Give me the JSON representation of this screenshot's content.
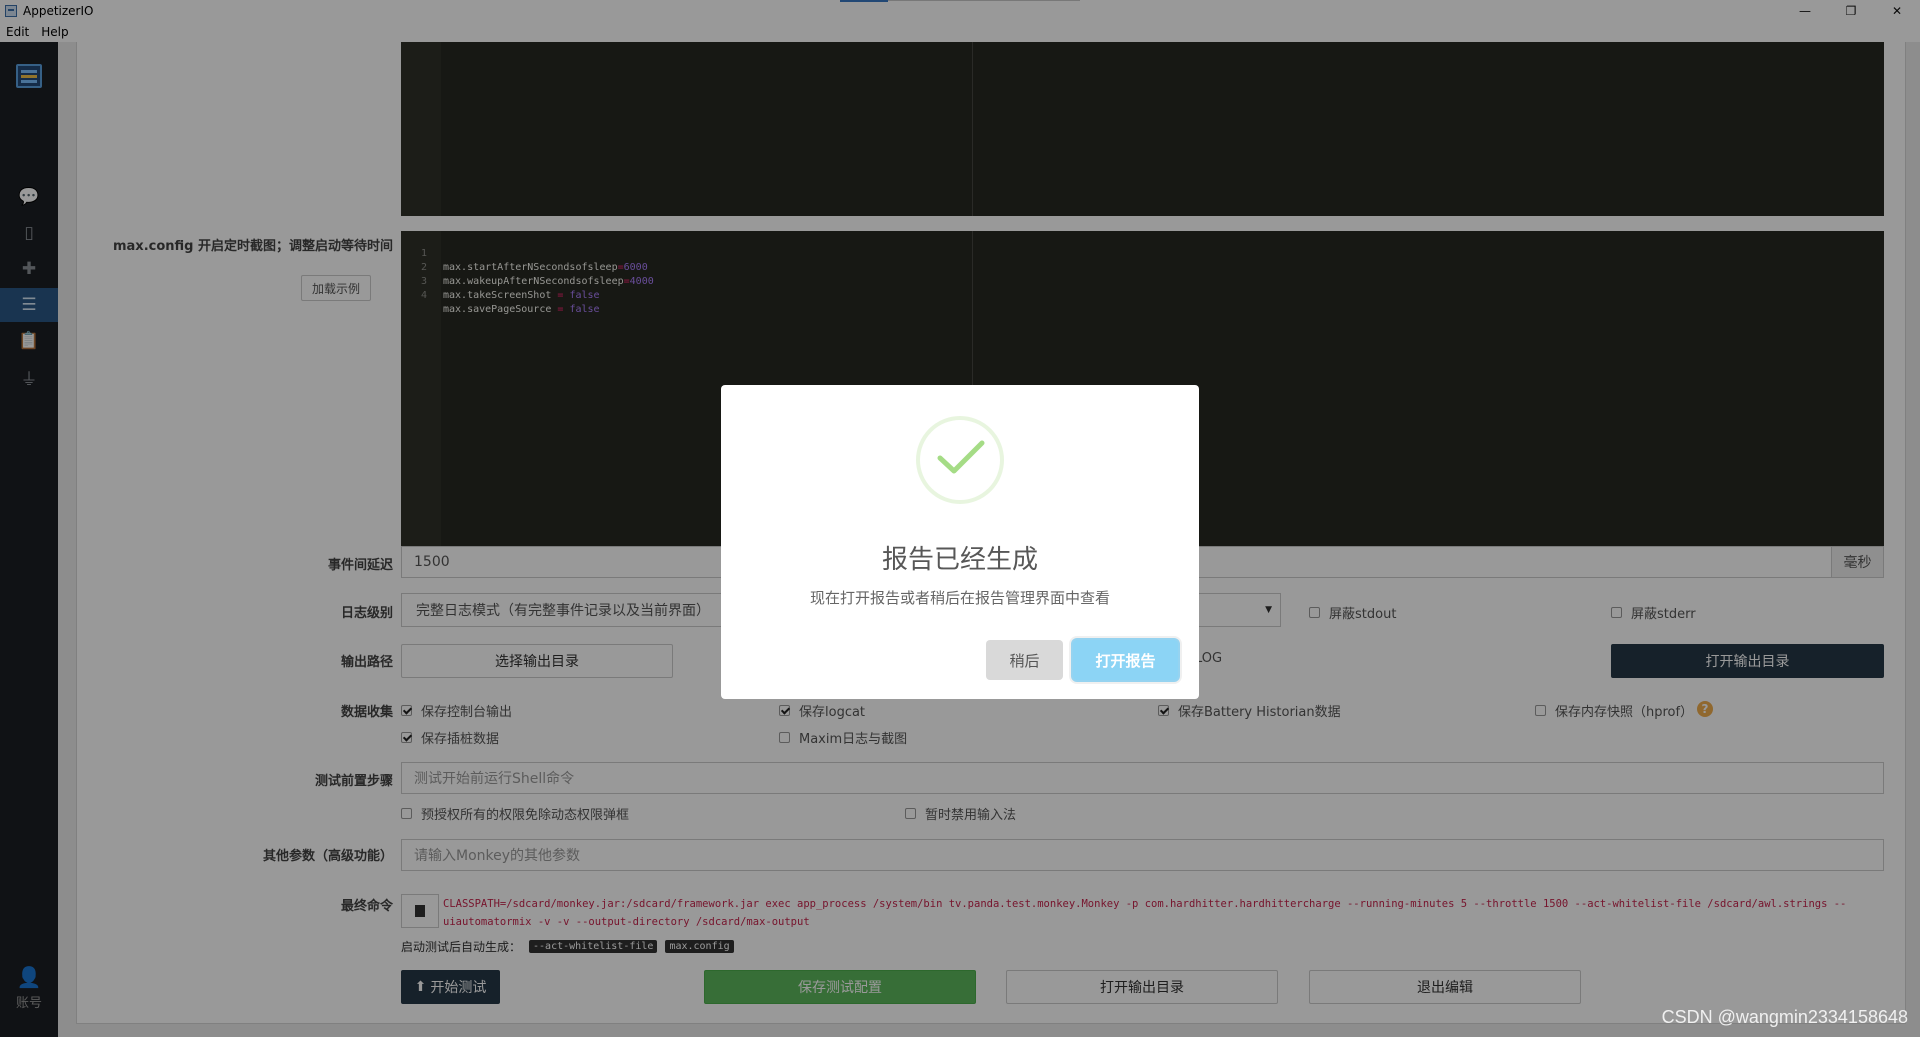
{
  "window": {
    "title": "AppetizerIO",
    "minimize": "—",
    "maximize": "❐",
    "close": "✕"
  },
  "menu": [
    "Edit",
    "Help"
  ],
  "sidebar": {
    "items": [
      {
        "name": "chat",
        "icon": "💬"
      },
      {
        "name": "device",
        "icon": "▯"
      },
      {
        "name": "plugin",
        "icon": "✚"
      },
      {
        "name": "task-list",
        "icon": "☰"
      },
      {
        "name": "clipboard",
        "icon": "📋"
      },
      {
        "name": "plug",
        "icon": "⏚"
      }
    ],
    "account_label": "账号"
  },
  "config_section": {
    "label": "max.config 开启定时截图；调整启动等待时间",
    "load_example": "加载示例",
    "code_lines": [
      {
        "num": "1",
        "key": "max.startAfterNSecondsofsleep",
        "op": "=",
        "val": "6000"
      },
      {
        "num": "2",
        "key": "max.wakeupAfterNSecondsofsleep",
        "op": "=",
        "val": "4000"
      },
      {
        "num": "3",
        "key": "max.takeScreenShot ",
        "op": "=",
        "val": " false"
      },
      {
        "num": "4",
        "key": "max.savePageSource ",
        "op": "=",
        "val": " false"
      }
    ]
  },
  "event_delay": {
    "label": "事件间延迟",
    "value": "1500",
    "unit": "毫秒"
  },
  "log_level": {
    "label": "日志级别",
    "value": "完整日志模式（有完整事件记录以及当前界面）",
    "mask_stdout": "屏蔽stdout",
    "mask_stderr": "屏蔽stderr"
  },
  "output_path": {
    "label": "输出路径",
    "choose_btn": "选择输出目录",
    "partial": "LOG",
    "open_btn": "打开输出目录"
  },
  "data_collection": {
    "label": "数据收集",
    "items": [
      {
        "text": "保存控制台输出",
        "checked": true
      },
      {
        "text": "保存logcat",
        "checked": true
      },
      {
        "text": "保存Battery Historian数据",
        "checked": true
      },
      {
        "text": "保存内存快照（hprof）",
        "checked": false
      },
      {
        "text": "保存插桩数据",
        "checked": true
      },
      {
        "text": "Maxim日志与截图",
        "checked": false
      }
    ],
    "help": "?"
  },
  "pre_steps": {
    "label": "测试前置步骤",
    "placeholder": "测试开始前运行Shell命令",
    "options": [
      {
        "text": "预授权所有的权限免除动态权限弹框",
        "checked": false
      },
      {
        "text": "暂时禁用输入法",
        "checked": false
      }
    ]
  },
  "other_params": {
    "label": "其他参数（高级功能）",
    "placeholder": "请输入Monkey的其他参数"
  },
  "final_command": {
    "label": "最终命令",
    "command": "CLASSPATH=/sdcard/monkey.jar:/sdcard/framework.jar exec app_process /system/bin tv.panda.test.monkey.Monkey -p com.hardhitter.hardhittercharge --running-minutes 5 --throttle 1500 --act-whitelist-file /sdcard/awl.strings --uiautomatormix -v -v --output-directory /sdcard/max-output",
    "auto_gen_label": "启动测试后自动生成：",
    "tags": [
      "--act-whitelist-file",
      "max.config"
    ]
  },
  "actions": {
    "start": "开始测试",
    "save": "保存测试配置",
    "open_dir": "打开输出目录",
    "exit": "退出编辑"
  },
  "modal": {
    "title": "报告已经生成",
    "text": "现在打开报告或者稍后在报告管理界面中查看",
    "later": "稍后",
    "open": "打开报告"
  },
  "watermark": "CSDN @wangmin2334158648",
  "colors": {
    "sidebar": "#1c1f24",
    "sidebar_active": "#2a5885",
    "editor_bg": "#272822",
    "primary_dark": "#263847",
    "success_green": "#5cb85c",
    "modal_confirm": "#8cd4f5",
    "check_green": "#a5dc86"
  }
}
